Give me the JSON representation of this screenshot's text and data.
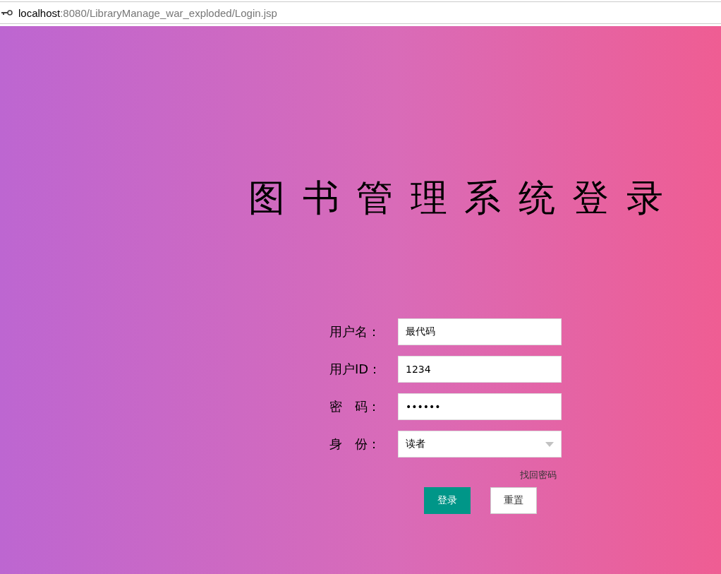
{
  "address_bar": {
    "host": "localhost",
    "path": ":8080/LibraryManage_war_exploded/Login.jsp"
  },
  "title": "图 书 管 理 系 统 登 录",
  "fields": [
    {
      "kind": "text",
      "label": "用户名：",
      "value": "最代码"
    },
    {
      "kind": "text",
      "label": "用户ID：",
      "value": "1234"
    },
    {
      "kind": "password",
      "label": "密　码：",
      "value": "••••••"
    },
    {
      "kind": "select",
      "label": "身　份：",
      "value": "读者"
    }
  ],
  "forgot_link": "找回密码",
  "buttons": [
    {
      "kind": "primary",
      "label": "登录"
    },
    {
      "kind": "plain",
      "label": "重置"
    }
  ]
}
